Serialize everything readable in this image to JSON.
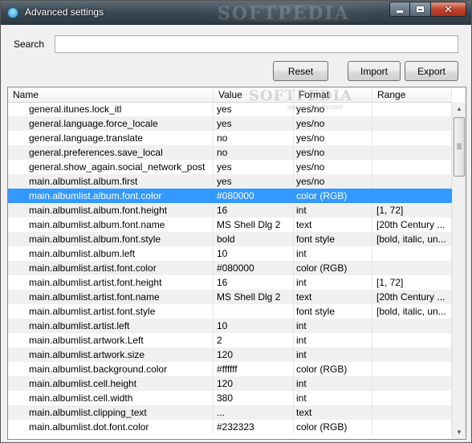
{
  "window": {
    "title": "Advanced settings",
    "watermark": "SOFTPEDIA",
    "controls": {
      "minimize": "minimize",
      "maximize": "maximize",
      "close": "✕"
    }
  },
  "search": {
    "label": "Search",
    "value": "",
    "placeholder": ""
  },
  "buttons": {
    "reset": "Reset",
    "import": "Import",
    "export": "Export"
  },
  "list": {
    "watermark": "SOFTPEDIA",
    "watermark_sub": "www.softpedia.com",
    "columns": [
      "Name",
      "Value",
      "Format",
      "Range"
    ],
    "selected_index": 6,
    "rows": [
      {
        "name": "general.itunes.lock_itl",
        "value": "yes",
        "format": "yes/no",
        "range": ""
      },
      {
        "name": "general.language.force_locale",
        "value": "yes",
        "format": "yes/no",
        "range": ""
      },
      {
        "name": "general.language.translate",
        "value": "no",
        "format": "yes/no",
        "range": ""
      },
      {
        "name": "general.preferences.save_local",
        "value": "no",
        "format": "yes/no",
        "range": ""
      },
      {
        "name": "general.show_again.social_network_post",
        "value": "yes",
        "format": "yes/no",
        "range": ""
      },
      {
        "name": "main.albumlist.album.first",
        "value": "yes",
        "format": "yes/no",
        "range": ""
      },
      {
        "name": "main.albumlist.album.font.color",
        "value": "#080000",
        "format": "color (RGB)",
        "range": ""
      },
      {
        "name": "main.albumlist.album.font.height",
        "value": "16",
        "format": "int",
        "range": "[1, 72]"
      },
      {
        "name": "main.albumlist.album.font.name",
        "value": "MS Shell Dlg 2",
        "format": "text",
        "range": "[20th Century ..."
      },
      {
        "name": "main.albumlist.album.font.style",
        "value": "bold",
        "format": "font style",
        "range": "[bold, italic, un..."
      },
      {
        "name": "main.albumlist.album.left",
        "value": "10",
        "format": "int",
        "range": ""
      },
      {
        "name": "main.albumlist.artist.font.color",
        "value": "#080000",
        "format": "color (RGB)",
        "range": ""
      },
      {
        "name": "main.albumlist.artist.font.height",
        "value": "16",
        "format": "int",
        "range": "[1, 72]"
      },
      {
        "name": "main.albumlist.artist.font.name",
        "value": "MS Shell Dlg 2",
        "format": "text",
        "range": "[20th Century ..."
      },
      {
        "name": "main.albumlist.artist.font.style",
        "value": "",
        "format": "font style",
        "range": "[bold, italic, un..."
      },
      {
        "name": "main.albumlist.artist.left",
        "value": "10",
        "format": "int",
        "range": ""
      },
      {
        "name": "main.albumlist.artwork.Left",
        "value": "2",
        "format": "int",
        "range": ""
      },
      {
        "name": "main.albumlist.artwork.size",
        "value": "120",
        "format": "int",
        "range": ""
      },
      {
        "name": "main.albumlist.background.color",
        "value": "#ffffff",
        "format": "color (RGB)",
        "range": ""
      },
      {
        "name": "main.albumlist.cell.height",
        "value": "120",
        "format": "int",
        "range": ""
      },
      {
        "name": "main.albumlist.cell.width",
        "value": "380",
        "format": "int",
        "range": ""
      },
      {
        "name": "main.albumlist.clipping_text",
        "value": "...",
        "format": "text",
        "range": ""
      },
      {
        "name": "main.albumlist.dot.font.color",
        "value": "#232323",
        "format": "color (RGB)",
        "range": ""
      }
    ]
  },
  "colors": {
    "selection": "#3399ff",
    "titlebar": "#3c4a55",
    "close": "#c2422b"
  }
}
